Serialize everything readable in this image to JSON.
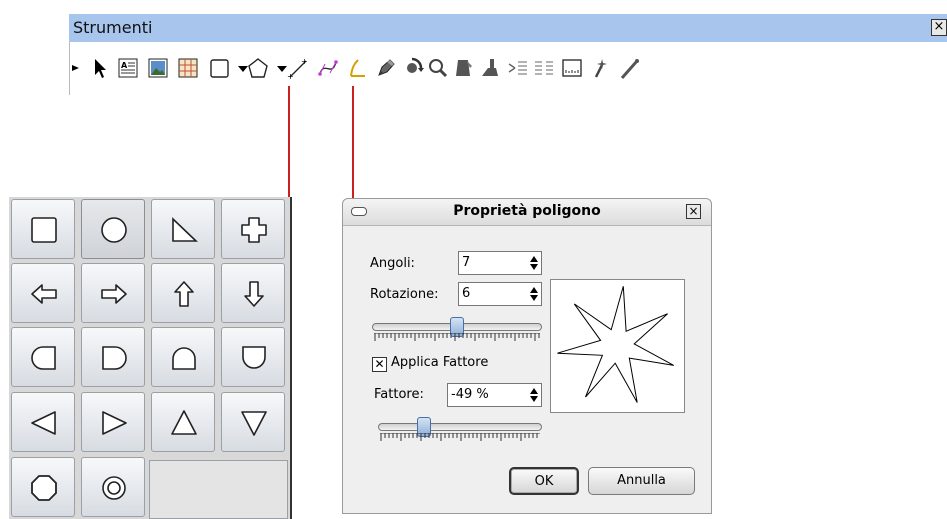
{
  "toolbar_window": {
    "title": "Strumenti",
    "close_glyph": "×",
    "tools": [
      {
        "name": "overflow-arrow-icon"
      },
      {
        "name": "select-arrow-icon"
      },
      {
        "name": "text-frame-icon"
      },
      {
        "name": "image-frame-icon"
      },
      {
        "name": "table-icon"
      },
      {
        "name": "rectangle-shape-icon"
      },
      {
        "name": "shape-dropdown-icon"
      },
      {
        "name": "polygon-icon"
      },
      {
        "name": "polygon-dropdown-icon"
      },
      {
        "name": "line-icon"
      },
      {
        "name": "bezier-icon"
      },
      {
        "name": "freehand-line-icon"
      },
      {
        "name": "pencil-icon"
      },
      {
        "name": "rotate-icon"
      },
      {
        "name": "zoom-icon"
      },
      {
        "name": "edit-contents-icon"
      },
      {
        "name": "eyedropper-icon"
      },
      {
        "name": "link-frames-icon"
      },
      {
        "name": "unlink-frames-icon"
      },
      {
        "name": "measure-icon"
      },
      {
        "name": "magic-wand-icon"
      },
      {
        "name": "copy-properties-icon"
      }
    ]
  },
  "shape_palette": {
    "rows": [
      [
        "square",
        "circle",
        "right-triangle",
        "cross"
      ],
      [
        "arrow-left",
        "arrow-right",
        "arrow-up",
        "arrow-down"
      ],
      [
        "half-round-left",
        "half-round-right",
        "arch-up",
        "arch-down"
      ],
      [
        "triangle-left",
        "triangle-right",
        "triangle-up",
        "triangle-down"
      ],
      [
        "octagon",
        "ring"
      ]
    ],
    "selected": "circle"
  },
  "polygon_dialog": {
    "title": "Proprietà poligono",
    "close_glyph": "×",
    "corners_label": "Angoli:",
    "corners_value": "7",
    "rotation_label": "Rotazione:",
    "rotation_value": "6",
    "rotation_slider_fraction": 0.5,
    "apply_factor_label": "Applica Fattore",
    "apply_factor_checked": true,
    "factor_label": "Fattore:",
    "factor_value": "-49 %",
    "factor_slider_fraction": 0.26,
    "ok_label": "OK",
    "cancel_label": "Annulla"
  },
  "colors": {
    "toolbar_title_bg": "#a8c5ee",
    "connector_line": "#cc2020",
    "slider_thumb": "#8fb0d8"
  }
}
